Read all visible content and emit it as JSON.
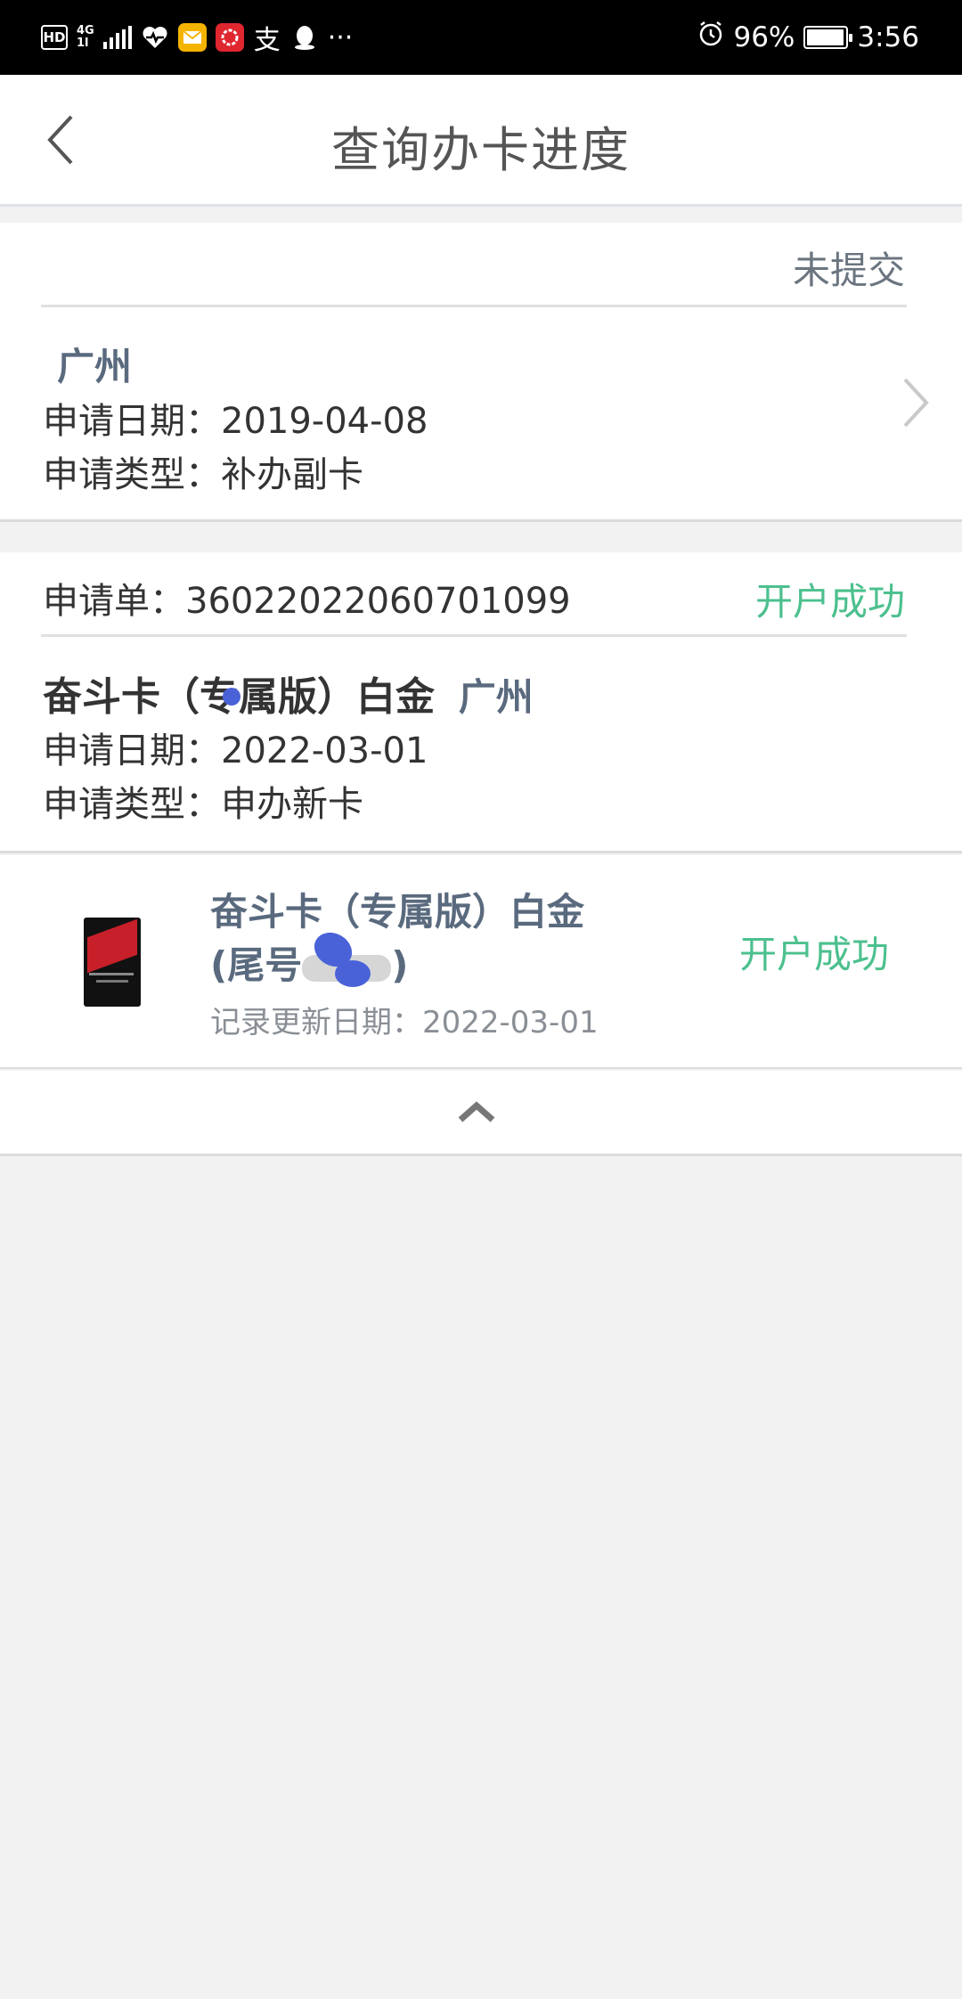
{
  "status_bar": {
    "badge": "HD",
    "network": "4G",
    "network_sub": "1l",
    "battery": "96%",
    "battery_level": 0.96,
    "time": "3:56",
    "more": "···"
  },
  "header": {
    "title": "查询办卡进度"
  },
  "application_1": {
    "status": "未提交",
    "city": "广州",
    "date": "申请日期：2019-04-08",
    "type": "申请类型：补办副卡"
  },
  "application_2": {
    "order_label": "申请单：36022022060701099",
    "status": "开户成功",
    "card_name": "奋斗卡（专属版）白金",
    "city": "广州",
    "date": "申请日期：2022-03-01",
    "type": "申请类型：申办新卡"
  },
  "card_record": {
    "name": "奋斗卡（专属版）白金",
    "tail_prefix": "(尾号",
    "tail_suffix": ")",
    "update_date": "记录更新日期：2022-03-01",
    "status": "开户成功"
  },
  "colors": {
    "success_green": "#4cc08e",
    "muted_gray": "#6b7580",
    "city_blue_gray": "#5a6a7e"
  }
}
